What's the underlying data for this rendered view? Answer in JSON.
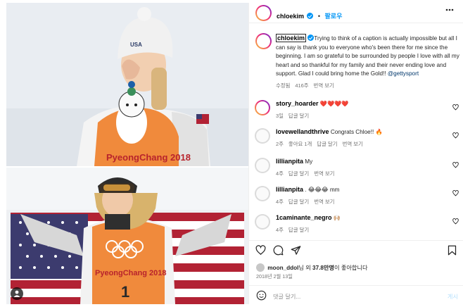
{
  "post": {
    "username": "chloekim",
    "follow_label": "팔로우",
    "caption_text": "Trying to think of a caption is actually impossible but all I can say is thank you to everyone who's been there for me since the beginning. I am so grateful to be surrounded by people I love with all my heart and so thankful for my family and their never ending love and support. Glad I could bring home the Gold!! ",
    "caption_mention": "@gettysport",
    "caption_meta": {
      "edited": "수정됨",
      "time": "416주",
      "translate": "번역 보기"
    },
    "likes_user": "moon_ddol",
    "likes_middle": "님 외 ",
    "likes_count": "37.8만명",
    "likes_suffix": "이 좋아합니다",
    "date": "2018년 2월 13일",
    "comment_placeholder": "댓글 달기...",
    "post_label": "게시"
  },
  "comments": [
    {
      "user": "story_hoarder",
      "text": "❤️❤️❤️❤️",
      "time": "3일",
      "likes": "",
      "reply": "답글 달기",
      "translate": ""
    },
    {
      "user": "lovewellandthrive",
      "text": "Congrats Chloe!! 🔥",
      "time": "2주",
      "likes": "좋아요 1개",
      "reply": "답글 달기",
      "translate": "번역 보기"
    },
    {
      "user": "lillianpita",
      "text": "My",
      "time": "4주",
      "likes": "",
      "reply": "답글 달기",
      "translate": "번역 보기"
    },
    {
      "user": "lillianpita",
      "text": ". 😂😂😂 mm",
      "time": "4주",
      "likes": "",
      "reply": "답글 달기",
      "translate": "번역 보기"
    },
    {
      "user": "1caminante_negro",
      "text": "🙌🏼",
      "time": "4주",
      "likes": "",
      "reply": "답글 달기",
      "translate": ""
    }
  ],
  "photo": {
    "top_banner_text": "PyeongChang 2018",
    "bottom_banner_text": "PyeongChang 2018",
    "bib_number": "1",
    "hat_text": "USA"
  },
  "icons": [
    "more-icon",
    "heart-icon",
    "comment-icon",
    "share-icon",
    "bookmark-icon",
    "emoji-icon",
    "user-tag-icon"
  ],
  "colors": {
    "accent": "#0095f6",
    "text": "#262626",
    "muted": "#737373",
    "border": "#efefef"
  }
}
